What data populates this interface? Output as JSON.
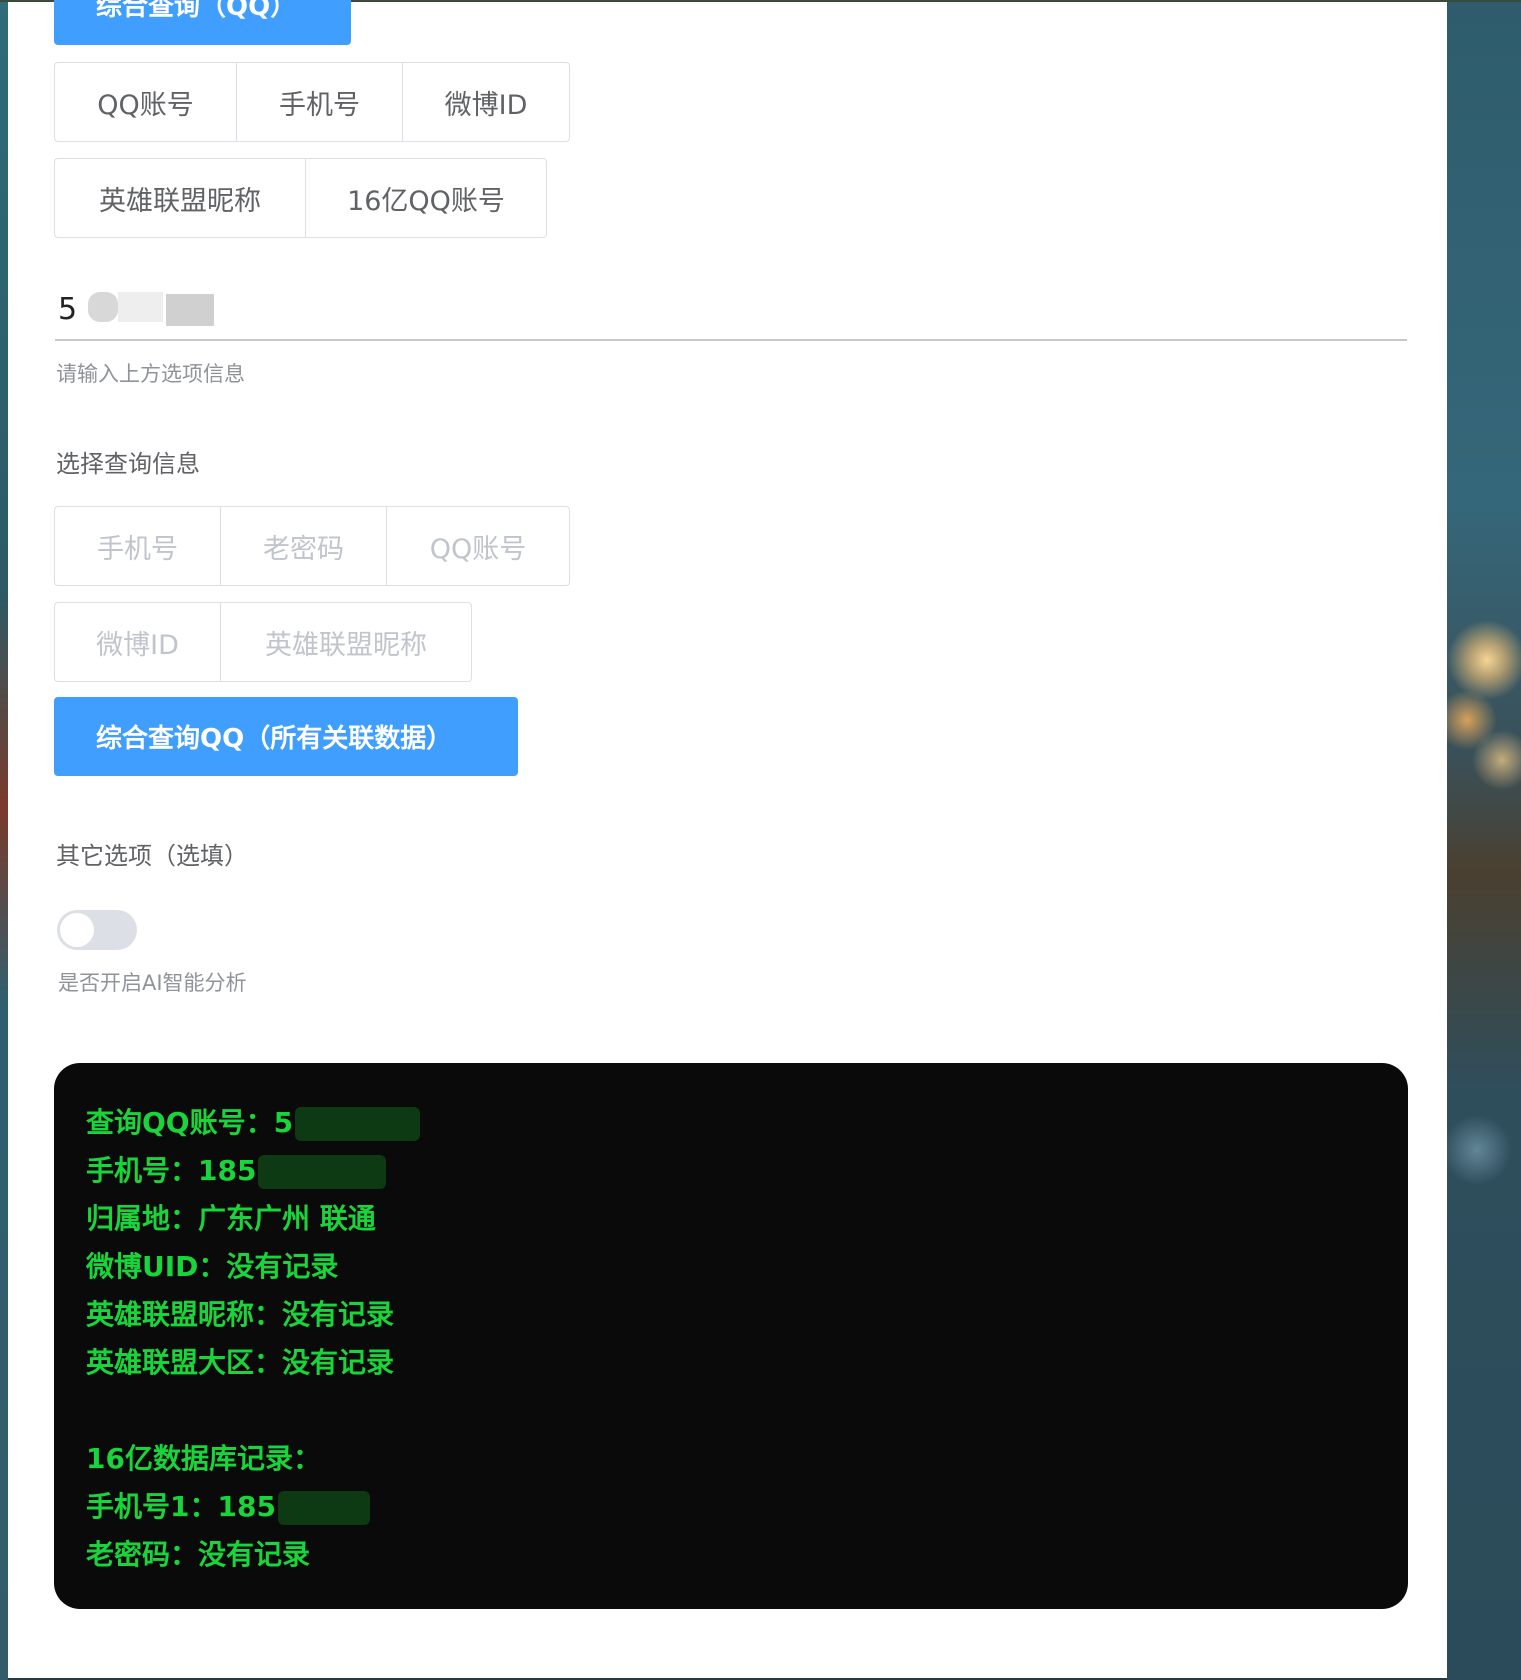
{
  "top_button": {
    "label": "综合查询（QQ）"
  },
  "input_type_options": {
    "row1": [
      "QQ账号",
      "手机号",
      "微博ID"
    ],
    "row2": [
      "英雄联盟昵称",
      "16亿QQ账号"
    ]
  },
  "query_input": {
    "value": "5",
    "hint": "请输入上方选项信息"
  },
  "select_section": {
    "title": "选择查询信息",
    "row1": [
      "手机号",
      "老密码",
      "QQ账号"
    ],
    "row2": [
      "微博ID",
      "英雄联盟昵称"
    ]
  },
  "query_button": {
    "label": "综合查询QQ（所有关联数据）"
  },
  "other_options": {
    "title": "其它选项（选填）",
    "ai_toggle_label": "是否开启AI智能分析",
    "ai_enabled": false
  },
  "result": {
    "qq_account": "查询QQ账号：5",
    "phone": "手机号：185",
    "location": "归属地：广东广州 联通",
    "weibo_uid": "微博UID：没有记录",
    "lol_nickname": "英雄联盟昵称：没有记录",
    "lol_region": "英雄联盟大区：没有记录",
    "db_title": "16亿数据库记录：",
    "phone1": "手机号1：185",
    "old_password": "老密码：没有记录"
  }
}
